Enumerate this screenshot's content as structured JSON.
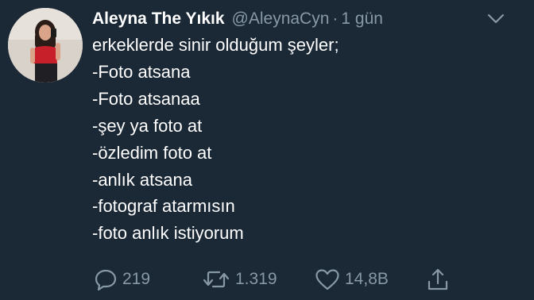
{
  "tweet": {
    "author": {
      "display_name": "Aleyna The Yıkık",
      "handle": "@AleynaCyn",
      "avatar_icon": "profile-photo"
    },
    "separator": "·",
    "time": "1 gün",
    "text_lines": [
      "erkeklerde sinir olduğum şeyler;",
      "-Foto atsana",
      "-Foto atsanaa",
      "-şey ya foto at",
      "-özledim foto at",
      "-anlık atsana",
      "-fotograf atarmısın",
      "-foto anlık istiyorum"
    ],
    "actions": {
      "reply_count": "219",
      "retweet_count": "1.319",
      "like_count": "14,8B"
    },
    "colors": {
      "background": "#1b2836",
      "text": "#ffffff",
      "muted": "#8899a6"
    }
  }
}
